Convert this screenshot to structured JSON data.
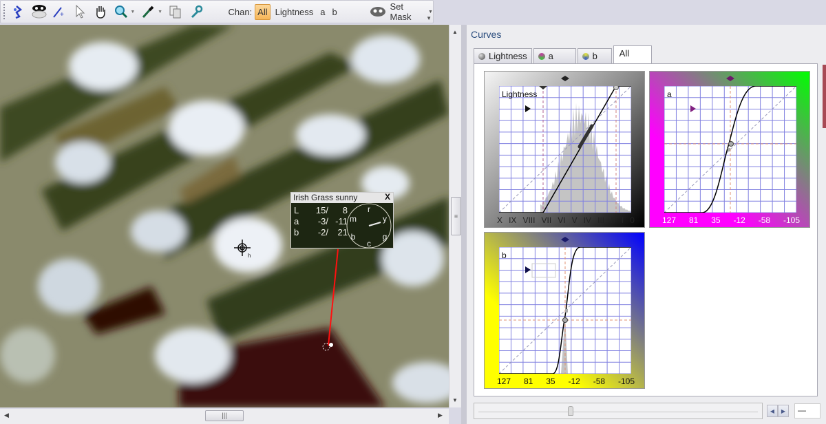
{
  "toolbar": {
    "tools": [
      {
        "name": "picker-tool",
        "icon": "color-picker-icon"
      },
      {
        "name": "mask-tool",
        "icon": "mask-icon"
      },
      {
        "name": "add-sample-tool",
        "icon": "add-point-wand-icon"
      },
      {
        "name": "select-tool",
        "icon": "arrow-cursor-icon"
      },
      {
        "name": "pan-tool",
        "icon": "hand-icon"
      },
      {
        "name": "zoom-tool",
        "icon": "magnifier-icon"
      },
      {
        "name": "eyedropper-tool",
        "icon": "eyedropper-icon"
      },
      {
        "name": "copy-tool",
        "icon": "copy-icon"
      },
      {
        "name": "settings-tool",
        "icon": "wrench-icon"
      }
    ],
    "chan_label": "Chan:",
    "channels": [
      "All",
      "Lightness",
      "a",
      "b"
    ],
    "active_channel": "All",
    "set_mask_label": "Set Mask"
  },
  "sampler": {
    "title": "Irish Grass  sunny",
    "close_label": "X",
    "rows": [
      {
        "ch": "L",
        "v1": "15/",
        "v2": "8"
      },
      {
        "ch": "a",
        "v1": "-3/",
        "v2": "-11"
      },
      {
        "ch": "b",
        "v1": "-2/",
        "v2": "21"
      }
    ],
    "dial_labels": {
      "top": "r",
      "right_top": "y",
      "right_bottom": "g",
      "bottom": "c",
      "left_bottom": "b",
      "left_top": "m"
    }
  },
  "panel": {
    "title": "Curves",
    "tabs": [
      {
        "label": "Lightness",
        "ball": "#555555"
      },
      {
        "label": "a",
        "ball": "#c040a0"
      },
      {
        "label": "b",
        "ball": "#4a8ac0"
      },
      {
        "label": "All",
        "ball": null
      }
    ],
    "active_tab": "All"
  },
  "curves": {
    "lightness": {
      "name": "Lightness",
      "axis_labels": [
        "X",
        "IX",
        "VIII",
        "VII",
        "VI",
        "V",
        "IV",
        "III",
        "II",
        "I",
        "0"
      ],
      "colors": {
        "left": "#ffffff",
        "right": "#000000"
      }
    },
    "a": {
      "name": "a",
      "axis_labels": [
        "127",
        "81",
        "35",
        "-12",
        "-58",
        "-105"
      ],
      "colors": {
        "low": "#ff00ff",
        "high": "#00ff00"
      }
    },
    "b": {
      "name": "b",
      "axis_labels": [
        "127",
        "81",
        "35",
        "-12",
        "-58",
        "-105"
      ],
      "colors": {
        "low": "#ffff00",
        "high": "#0000ff"
      }
    }
  },
  "bottom": {
    "slider_value": 0.33,
    "value_text": "—",
    "prev_label": "◀",
    "next_label": "▶"
  },
  "scrollbars": {
    "h_label": "|||",
    "v_label": "≡"
  }
}
